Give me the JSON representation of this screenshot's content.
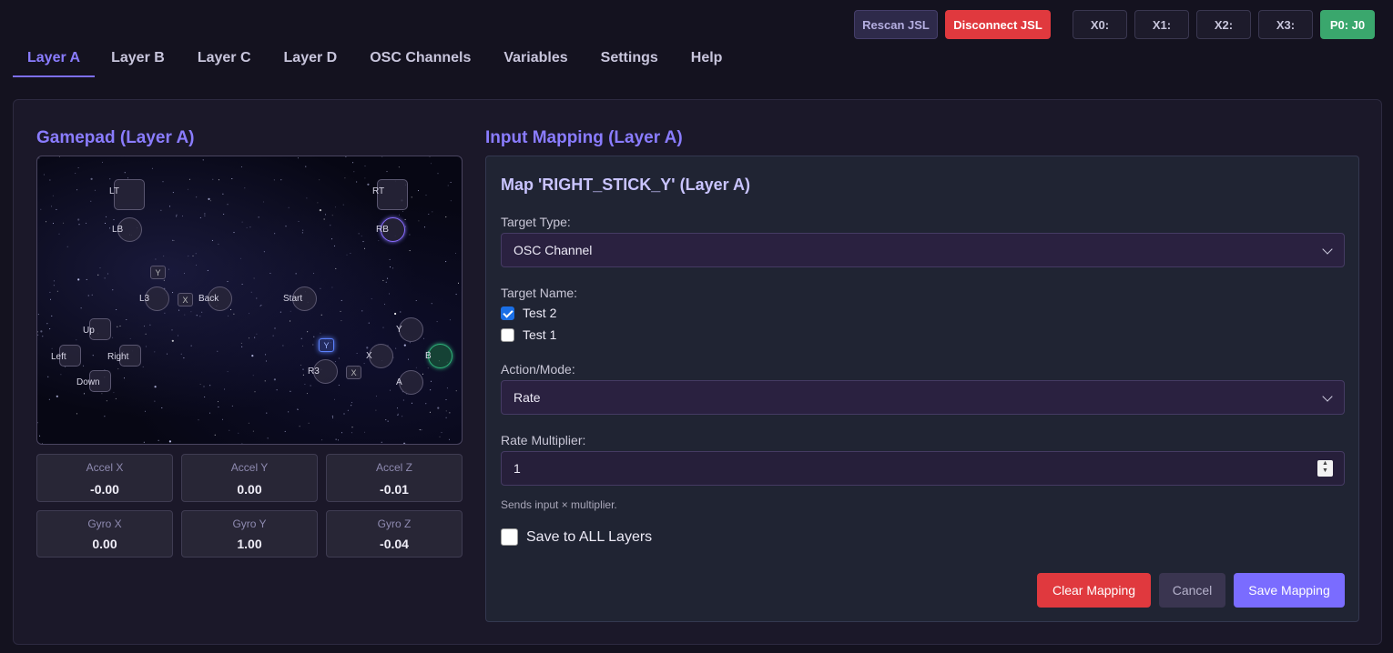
{
  "topbar": {
    "rescan": "Rescan JSL",
    "disconnect": "Disconnect JSL",
    "slots": [
      "X0:",
      "X1:",
      "X2:",
      "X3:"
    ],
    "player": "P0: J0"
  },
  "tabs": [
    "Layer A",
    "Layer B",
    "Layer C",
    "Layer D",
    "OSC Channels",
    "Variables",
    "Settings",
    "Help"
  ],
  "active_tab": "Layer A",
  "gamepad": {
    "title": "Gamepad (Layer A)",
    "labels": {
      "lt": "LT",
      "rt": "RT",
      "lb": "LB",
      "rb": "RB",
      "l3": "L3",
      "r3": "R3",
      "back": "Back",
      "start": "Start",
      "up": "Up",
      "down": "Down",
      "left": "Left",
      "right": "Right",
      "y": "Y",
      "x": "X",
      "a": "A",
      "b": "B",
      "ls_y": "Y",
      "ls_x": "X",
      "rs_y": "Y",
      "rs_x": "X"
    },
    "highlighted": [
      "RB",
      "B",
      "RIGHT_STICK_Y"
    ]
  },
  "sensors": [
    {
      "label": "Accel X",
      "value": "-0.00"
    },
    {
      "label": "Accel Y",
      "value": "0.00"
    },
    {
      "label": "Accel Z",
      "value": "-0.01"
    },
    {
      "label": "Gyro X",
      "value": "0.00"
    },
    {
      "label": "Gyro Y",
      "value": "1.00"
    },
    {
      "label": "Gyro Z",
      "value": "-0.04"
    }
  ],
  "mapping": {
    "section_title": "Input Mapping (Layer A)",
    "card_title": "Map 'RIGHT_STICK_Y' (Layer A)",
    "target_type_label": "Target Type:",
    "target_type_value": "OSC Channel",
    "target_name_label": "Target Name:",
    "targets": [
      {
        "name": "Test 2",
        "checked": true
      },
      {
        "name": "Test 1",
        "checked": false
      }
    ],
    "action_label": "Action/Mode:",
    "action_value": "Rate",
    "rate_label": "Rate Multiplier:",
    "rate_value": "1",
    "hint": "Sends input × multiplier.",
    "save_all_label": "Save to ALL Layers",
    "save_all_checked": false,
    "clear": "Clear Mapping",
    "cancel": "Cancel",
    "save": "Save Mapping"
  },
  "colors": {
    "accent": "#7d6ff5",
    "danger": "#e0393e",
    "success": "#3aa76d",
    "background": "#14121f"
  }
}
